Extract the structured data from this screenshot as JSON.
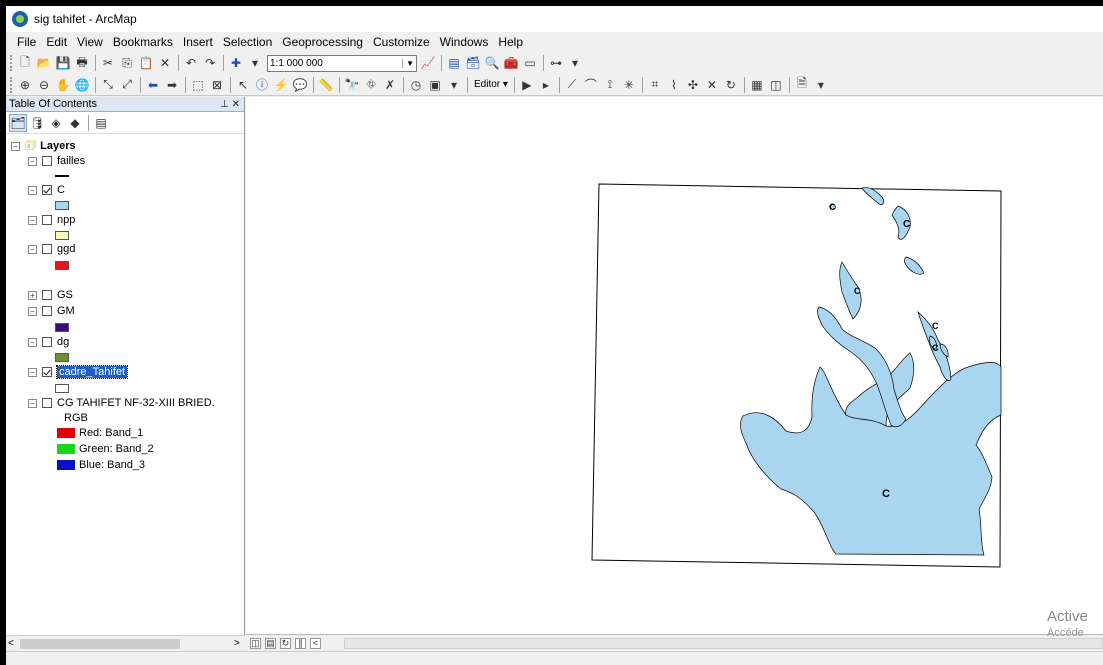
{
  "window": {
    "title": "sig tahifet - ArcMap"
  },
  "menu": [
    "File",
    "Edit",
    "View",
    "Bookmarks",
    "Insert",
    "Selection",
    "Geoprocessing",
    "Customize",
    "Windows",
    "Help"
  ],
  "toolbar": {
    "scale_value": "1:1 000 000",
    "editor_label": "Editor ▾"
  },
  "toc": {
    "title": "Table Of Contents",
    "controls": "\u0001 ✕",
    "root_label": "Layers",
    "layers": [
      {
        "name": "failles",
        "checked": false,
        "symbol": "line",
        "color": "#000000"
      },
      {
        "name": "C",
        "checked": true,
        "symbol": "fill",
        "color": "#a9d5f1"
      },
      {
        "name": "npp",
        "checked": false,
        "symbol": "fill",
        "color": "#fbfcb8"
      },
      {
        "name": "ggd",
        "checked": false,
        "symbol": "fill",
        "color": "#e8151b"
      },
      {
        "name": "GS",
        "checked": false,
        "symbol": "none",
        "color": ""
      },
      {
        "name": "GM",
        "checked": false,
        "symbol": "fill",
        "color": "#3b0d7a"
      },
      {
        "name": "dg",
        "checked": false,
        "symbol": "fill",
        "color": "#6e8e2f"
      },
      {
        "name": "cadre_Tahifet",
        "checked": true,
        "symbol": "fill",
        "color": "#ffffff"
      },
      {
        "name": "CG TAHIFET NF-32-XIII BRIED.",
        "checked": false,
        "symbol": "raster",
        "color": ""
      }
    ],
    "raster_label": "RGB",
    "bands": [
      {
        "label": "Red:   Band_1",
        "color": "#e00000"
      },
      {
        "label": "Green: Band_2",
        "color": "#19d419"
      },
      {
        "label": "Blue:   Band_3",
        "color": "#0a10c8"
      }
    ]
  },
  "map": {
    "feature_fill": "#a9d5f1",
    "labels": [
      "C",
      "C",
      "C",
      "C",
      "C",
      "C"
    ]
  },
  "watermark": {
    "line1": "Active",
    "line2": "Accéde"
  }
}
